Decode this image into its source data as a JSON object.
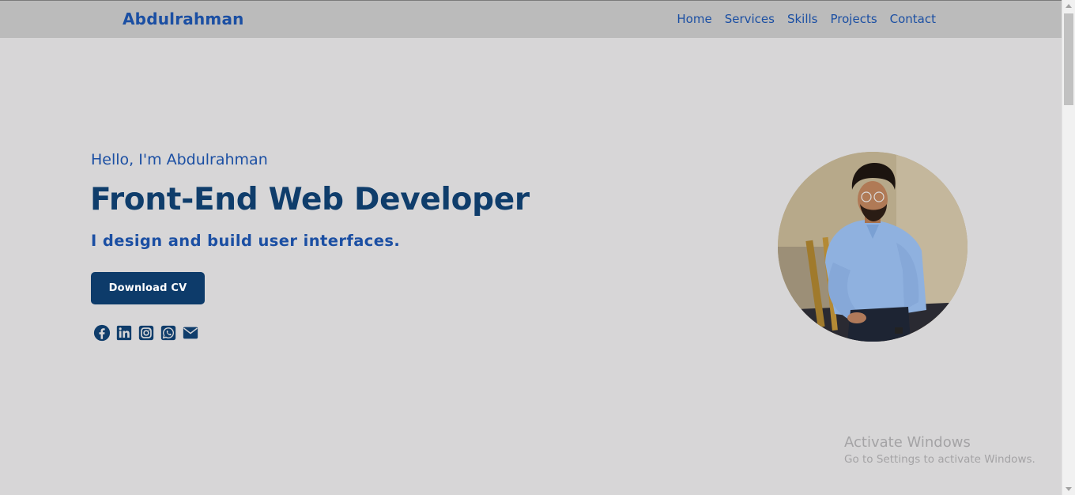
{
  "navbar": {
    "brand": "Abdulrahman",
    "links": [
      "Home",
      "Services",
      "Skills",
      "Projects",
      "Contact"
    ]
  },
  "hero": {
    "greeting": "Hello, I'm Abdulrahman",
    "title": "Front-End Web Developer",
    "subtitle": "I design and build user interfaces.",
    "download_label": "Download CV",
    "socials": [
      "facebook-icon",
      "linkedin-icon",
      "instagram-icon",
      "whatsapp-icon",
      "envelope-icon"
    ]
  },
  "watermark": {
    "title": "Activate Windows",
    "subtitle": "Go to Settings to activate Windows."
  },
  "colors": {
    "background": "#d7d6d7",
    "navbar": "#bbbbbb",
    "brand_blue": "#1b4fa3",
    "dark_navy": "#0f3d6b",
    "button": "#0d3b6a"
  }
}
